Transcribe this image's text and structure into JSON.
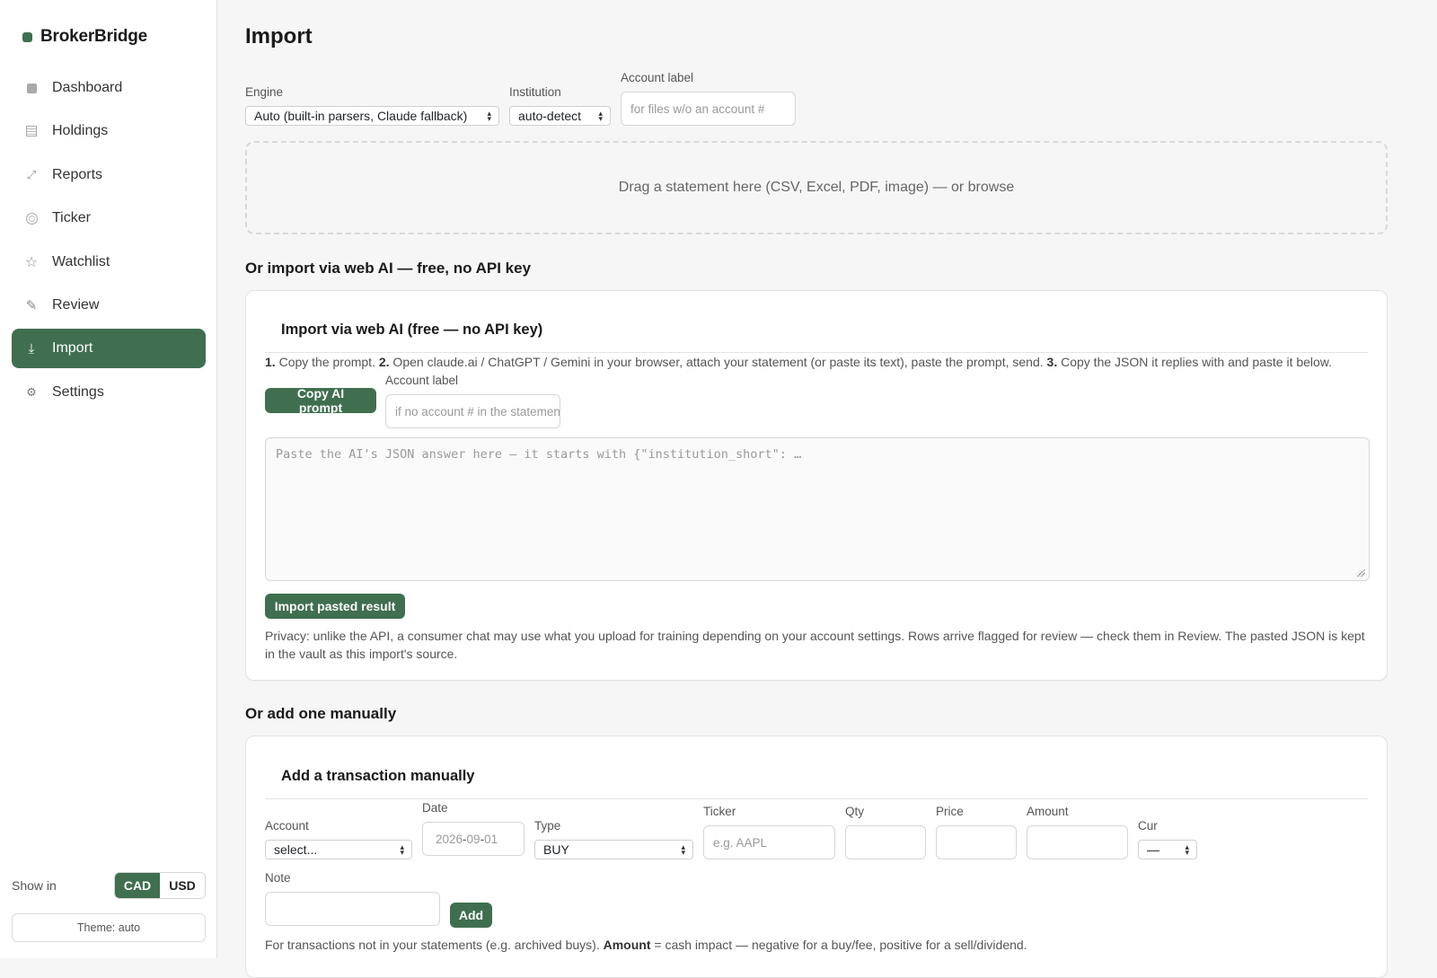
{
  "brand": {
    "name": "BrokerBridge",
    "accent": "#3f6f4f"
  },
  "sidebar": {
    "items": [
      {
        "label": "Dashboard",
        "icon": "square-icon"
      },
      {
        "label": "Holdings",
        "icon": "lines-icon"
      },
      {
        "label": "Reports",
        "icon": "chart-icon"
      },
      {
        "label": "Ticker",
        "icon": "ring-icon"
      },
      {
        "label": "Watchlist",
        "icon": "star-icon"
      },
      {
        "label": "Review",
        "icon": "pencil-icon"
      },
      {
        "label": "Import",
        "icon": "download-icon",
        "active": true
      },
      {
        "label": "Settings",
        "icon": "gear-icon"
      }
    ],
    "show_in": {
      "label": "Show in",
      "options": [
        "CAD",
        "USD"
      ],
      "selected": "CAD"
    },
    "theme": "Theme: auto"
  },
  "page": {
    "title": "Import"
  },
  "upload": {
    "engine": {
      "label": "Engine",
      "value": "Auto (built-in parsers, Claude fallback)"
    },
    "institution": {
      "label": "Institution",
      "value": "auto-detect"
    },
    "account": {
      "label": "Account label",
      "placeholder": "for files w/o an account #"
    },
    "dropzone": "Drag a statement here (CSV, Excel, PDF, image) — or browse"
  },
  "web_ai": {
    "section_heading": "Or import via web AI — free, no API key",
    "card_title": "Import via web AI (free — no API key)",
    "steps": {
      "n1": "1.",
      "s1": " Copy the prompt. ",
      "n2": "2.",
      "s2": " Open claude.ai / ChatGPT / Gemini in your browser, attach your statement (or paste its text), paste the prompt, send. ",
      "n3": "3.",
      "s3": " Copy the JSON it replies with and paste it below."
    },
    "copy_button": "Copy AI prompt",
    "account": {
      "label": "Account label",
      "placeholder": "if no account # in the statement"
    },
    "json_placeholder": "Paste the AI's JSON answer here — it starts with {\"institution_short\": …",
    "import_button": "Import pasted result",
    "privacy": "Privacy: unlike the API, a consumer chat may use what you upload for training depending on your account settings. Rows arrive flagged for review — check them in Review. The pasted JSON is kept in the vault as this import's source."
  },
  "manual": {
    "section_heading": "Or add one manually",
    "card_title": "Add a transaction manually",
    "fields": {
      "account": {
        "label": "Account",
        "value": "select..."
      },
      "date": {
        "label": "Date",
        "yyyy": "2026",
        "mm": "09",
        "dd": "01",
        "sep": "-"
      },
      "type": {
        "label": "Type",
        "value": "BUY"
      },
      "ticker": {
        "label": "Ticker",
        "placeholder": "e.g. AAPL"
      },
      "qty": {
        "label": "Qty"
      },
      "price": {
        "label": "Price"
      },
      "amount": {
        "label": "Amount"
      },
      "cur": {
        "label": "Cur",
        "value": "—"
      },
      "note": {
        "label": "Note"
      }
    },
    "add_button": "Add",
    "help": {
      "pre": "For transactions not in your statements (e.g. archived buys). ",
      "bold": "Amount",
      "post": " = cash impact — negative for a buy/fee, positive for a sell/dividend."
    }
  }
}
